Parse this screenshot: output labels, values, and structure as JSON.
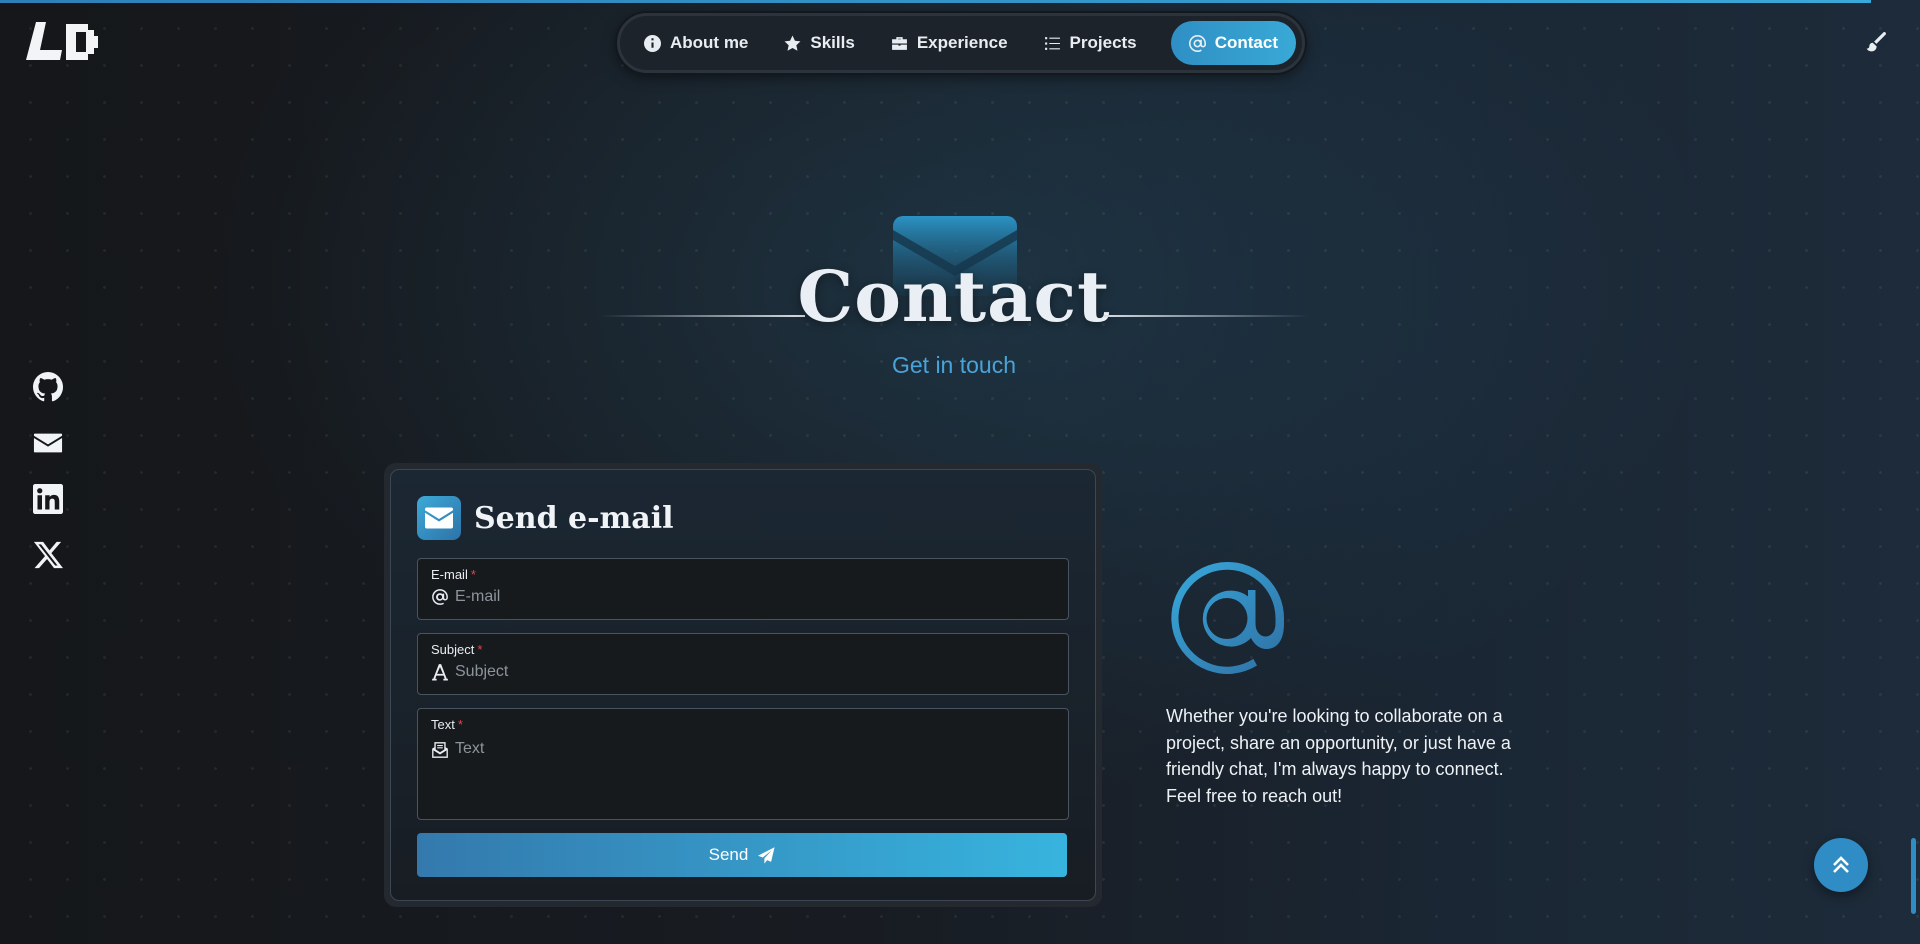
{
  "brand": {
    "logo_text": "LD"
  },
  "nav": {
    "items": [
      {
        "label": "About me",
        "icon": "info-circle-icon"
      },
      {
        "label": "Skills",
        "icon": "star-icon"
      },
      {
        "label": "Experience",
        "icon": "briefcase-icon"
      },
      {
        "label": "Projects",
        "icon": "list-icon"
      },
      {
        "label": "Contact",
        "icon": "at-icon",
        "active": true
      }
    ]
  },
  "theme_toggle": {
    "icon": "paintbrush-icon"
  },
  "social": [
    {
      "name": "github",
      "icon": "github-icon"
    },
    {
      "name": "email",
      "icon": "envelope-icon"
    },
    {
      "name": "linkedin",
      "icon": "linkedin-icon"
    },
    {
      "name": "x",
      "icon": "x-twitter-icon"
    }
  ],
  "section": {
    "title": "Contact",
    "subtitle": "Get in touch"
  },
  "form": {
    "title": "Send e-mail",
    "fields": {
      "email": {
        "label": "E-mail",
        "required_mark": "*",
        "placeholder": "E-mail",
        "value": ""
      },
      "subject": {
        "label": "Subject",
        "required_mark": "*",
        "placeholder": "Subject",
        "value": ""
      },
      "text": {
        "label": "Text",
        "required_mark": "*",
        "placeholder": "Text",
        "value": ""
      }
    },
    "submit_label": "Send"
  },
  "contact_blurb": "Whether you're looking to collaborate on a project, share an opportunity, or just have a friendly chat, I'm always happy to connect. Feel free to reach out!",
  "colors": {
    "accent": "#39a9d6",
    "accent_dark": "#2f7fb8",
    "background": "#15181c",
    "required": "#e0464e"
  }
}
